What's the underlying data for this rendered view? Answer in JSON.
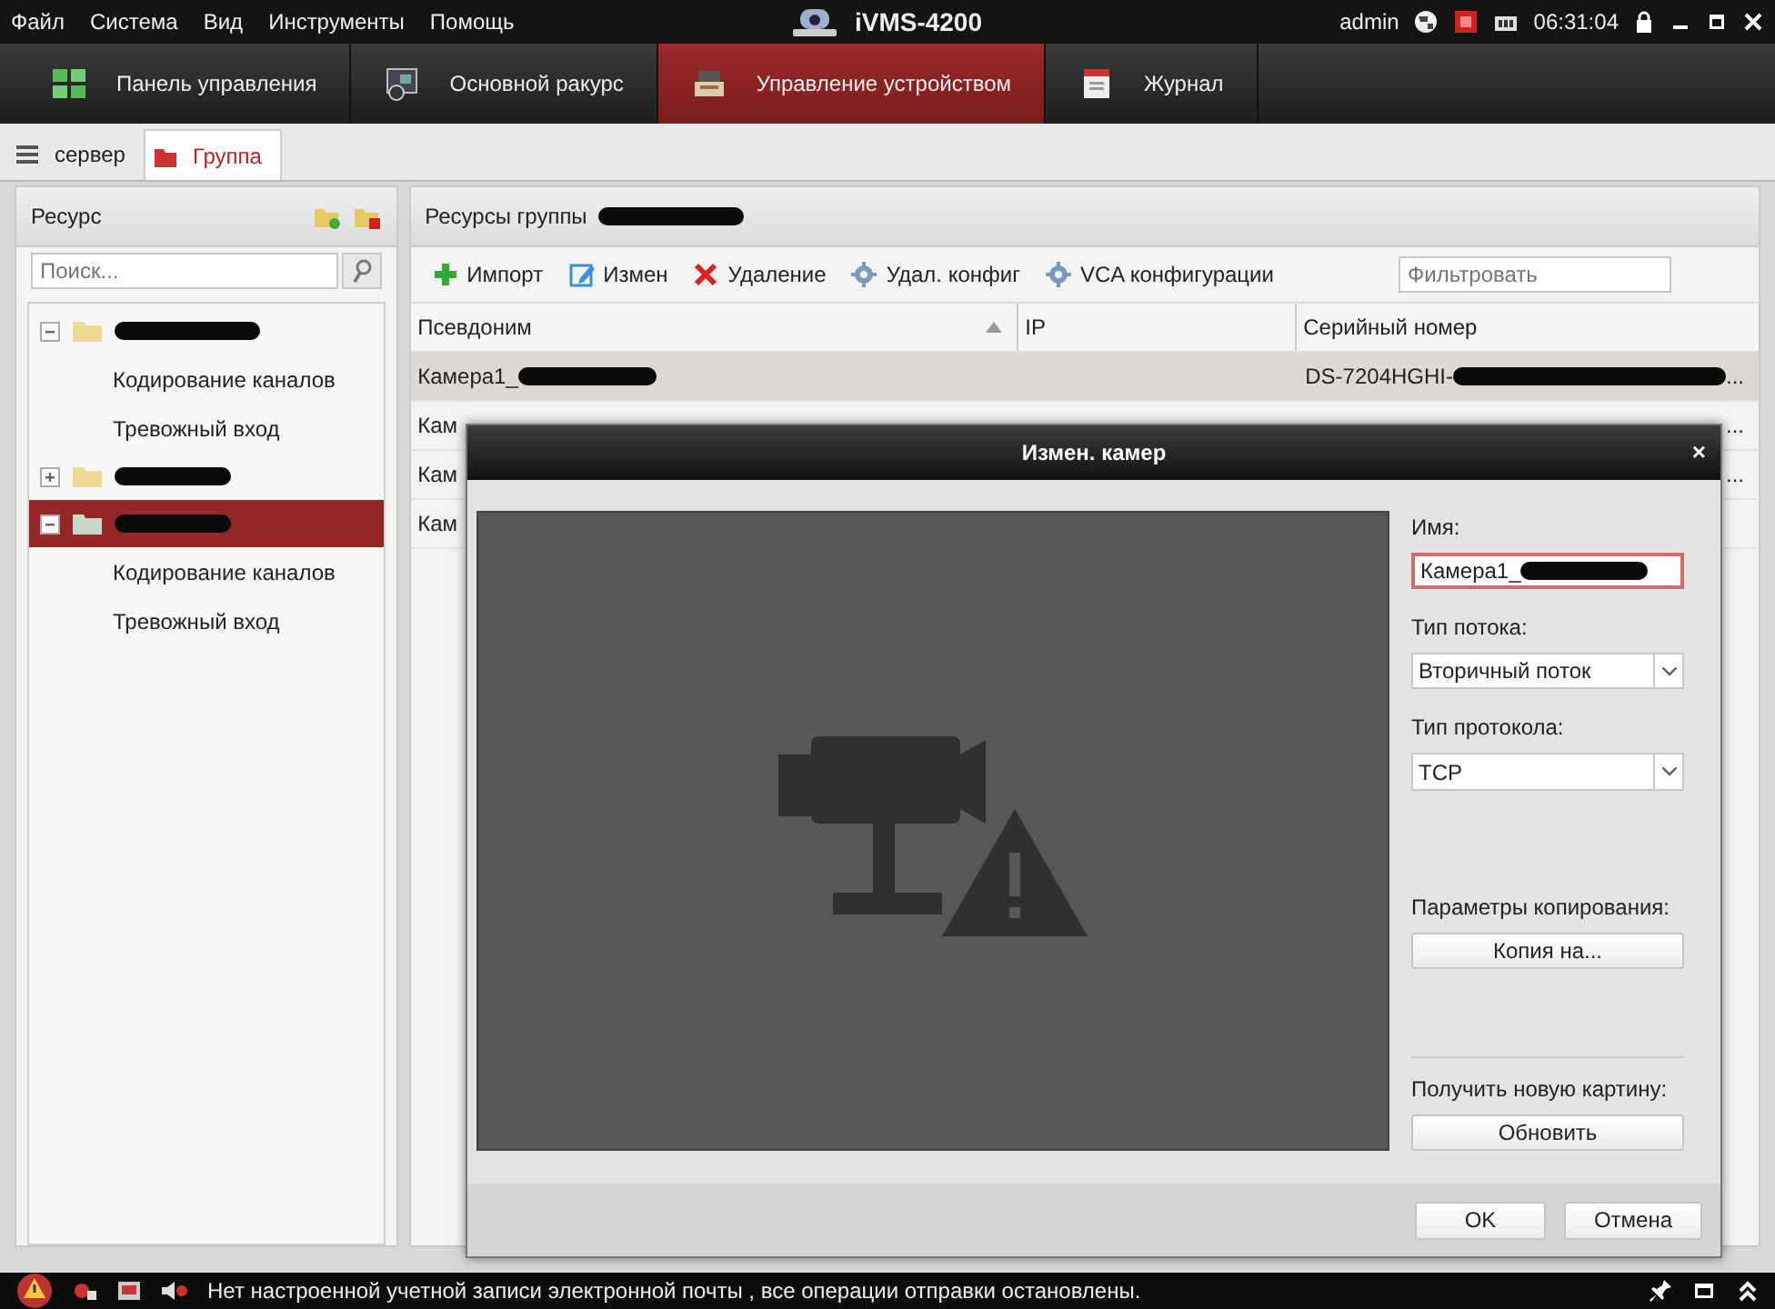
{
  "menu": [
    "Файл",
    "Система",
    "Вид",
    "Инструменты",
    "Помощь"
  ],
  "app_title": "iVMS-4200",
  "user": "admin",
  "clock": "06:31:04",
  "main_tabs": [
    {
      "label": "Панель управления",
      "selected": false
    },
    {
      "label": "Основной ракурс",
      "selected": false
    },
    {
      "label": "Управление устройством",
      "selected": true
    },
    {
      "label": "Журнал",
      "selected": false
    }
  ],
  "sub_tabs": [
    {
      "label": "сервер",
      "selected": false
    },
    {
      "label": "Группа",
      "selected": true
    }
  ],
  "resource_panel": {
    "title": "Ресурс",
    "search": {
      "placeholder": "Поиск..."
    },
    "tree": [
      {
        "redacted": true,
        "expanded": true,
        "selected": false,
        "children": [
          {
            "label": "Кодирование каналов"
          },
          {
            "label": "Тревожный вход"
          }
        ]
      },
      {
        "redacted": true,
        "expanded": false,
        "selected": false
      },
      {
        "redacted": true,
        "expanded": true,
        "selected": true,
        "children": [
          {
            "label": "Кодирование каналов"
          },
          {
            "label": "Тревожный вход"
          }
        ]
      }
    ]
  },
  "group_panel": {
    "title": "Ресурсы группы",
    "title_redacted": true,
    "toolbar": [
      {
        "kind": "add",
        "label": "Импорт"
      },
      {
        "kind": "edit",
        "label": "Измен"
      },
      {
        "kind": "delete",
        "label": "Удаление"
      },
      {
        "kind": "gear",
        "label": "Удал. конфиг"
      },
      {
        "kind": "gear",
        "label": "VCA конфигурации"
      }
    ],
    "filter": {
      "placeholder": "Фильтровать"
    },
    "columns": [
      {
        "label": "Псевдоним",
        "sorted": true
      },
      {
        "label": "IP",
        "sorted": false
      },
      {
        "label": "Серийный номер",
        "sorted": false
      }
    ],
    "rows": [
      {
        "selected": true,
        "alias": "Камера1_",
        "alias_redacted": true,
        "serial": "DS-7204HGHI-",
        "serial_redacted": true,
        "serial_more": "..."
      },
      {
        "selected": false,
        "alias": "Кам",
        "serial_more": "..."
      },
      {
        "selected": false,
        "alias": "Кам",
        "serial_more": "..."
      },
      {
        "selected": false,
        "alias": "Кам"
      }
    ]
  },
  "dialog": {
    "title": "Измен. камер",
    "close": "×",
    "fields": [
      {
        "kind": "text",
        "label": "Имя:",
        "value": "Камера1_",
        "redacted": true,
        "focused": true
      },
      {
        "kind": "select",
        "label": "Тип потока:",
        "value": "Вторичный поток"
      },
      {
        "kind": "select",
        "label": "Тип протокола:",
        "value": "TCP"
      }
    ],
    "copy": {
      "label": "Параметры копирования:",
      "button": "Копия на..."
    },
    "refresh": {
      "label": "Получить новую картину:",
      "button": "Обновить"
    },
    "buttons": [
      "OK",
      "Отмена"
    ]
  },
  "status_bar": {
    "message": "Нет настроенной учетной записи электронной почты , все операции отправки остановлены."
  }
}
